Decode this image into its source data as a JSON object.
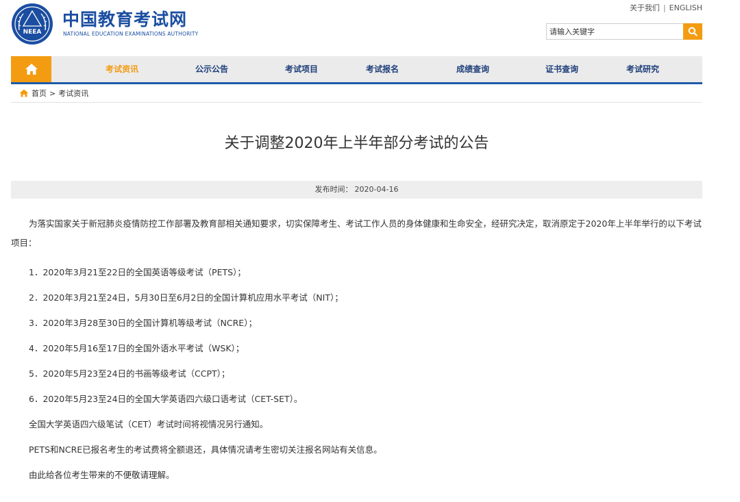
{
  "header": {
    "logo_cn": "中国教育考试网",
    "logo_en": "NATIONAL EDUCATION EXAMINATIONS AUTHORITY",
    "emblem_text": "NEEA",
    "top_links": {
      "about": "关于我们",
      "separator": "|",
      "english": "ENGLISH"
    },
    "search": {
      "placeholder": "请输入关键字"
    }
  },
  "nav": {
    "items": [
      {
        "label": "考试资讯",
        "active": true
      },
      {
        "label": "公示公告"
      },
      {
        "label": "考试项目"
      },
      {
        "label": "考试报名"
      },
      {
        "label": "成绩查询"
      },
      {
        "label": "证书查询"
      },
      {
        "label": "考试研究"
      }
    ]
  },
  "breadcrumb": {
    "home": "首页",
    "separator": ">",
    "current": "考试资讯"
  },
  "article": {
    "title": "关于调整2020年上半年部分考试的公告",
    "publish_label": "发布时间：",
    "publish_date": "2020-04-16",
    "lead": "为落实国家关于新冠肺炎疫情防控工作部署及教育部相关通知要求，切实保障考生、考试工作人员的身体健康和生命安全，经研究决定，取消原定于2020年上半年举行的以下考试项目：",
    "items": [
      "1．2020年3月21至22日的全国英语等级考试（PETS）；",
      "2．2020年3月21至24日，5月30日至6月2日的全国计算机应用水平考试（NIT）；",
      "3．2020年3月28至30日的全国计算机等级考试（NCRE）；",
      "4．2020年5月16至17日的全国外语水平考试（WSK）；",
      "5．2020年5月23至24日的书画等级考试（CCPT）；",
      "6．2020年5月23至24日的全国大学英语四六级口语考试（CET-SET）。"
    ],
    "notes": [
      "全国大学英语四六级笔试（CET）考试时间将视情况另行通知。",
      "PETS和NCRE已报名考生的考试费将全额退还，具体情况请考生密切关注报名网站有关信息。",
      "由此给各位考生带来的不便敬请理解。"
    ]
  },
  "colors": {
    "brand_blue": "#1b4ea1",
    "accent_orange": "#f39c12",
    "nav_bg": "#ebebeb"
  },
  "icons": {
    "home": "home-icon",
    "search": "search-icon",
    "emblem": "neea-emblem-icon"
  }
}
